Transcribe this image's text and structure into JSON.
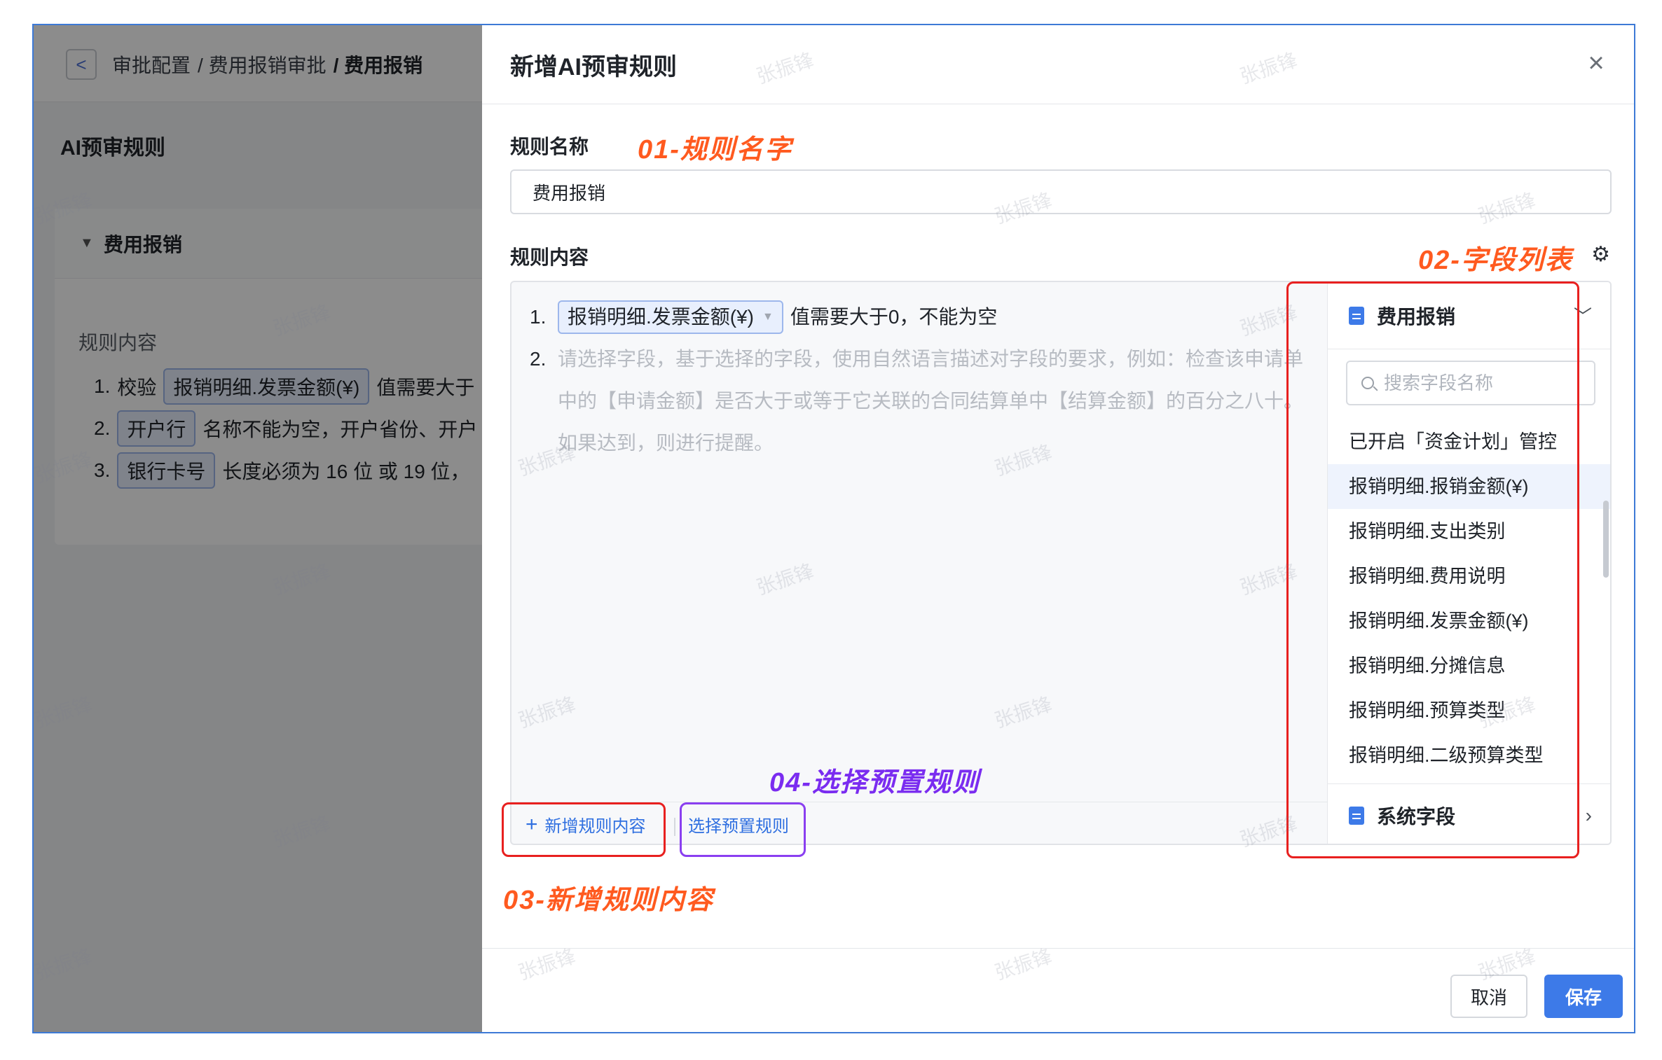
{
  "breadcrumb": {
    "back": "<",
    "items": [
      "审批配置",
      "/ 费用报销审批",
      "/ 费用报销"
    ]
  },
  "background": {
    "section_title": "AI预审规则",
    "card_title": "费用报销",
    "rule_label": "规则内容",
    "rules": [
      {
        "num": "1.",
        "prefix": "校验",
        "chip": "报销明细.发票金额(¥)",
        "text": "值需要大于"
      },
      {
        "num": "2.",
        "prefix": "",
        "chip": "开户行",
        "text": "名称不能为空，开户省份、开户"
      },
      {
        "num": "3.",
        "prefix": "",
        "chip": "银行卡号",
        "text": "长度必须为 16 位 或 19 位，"
      }
    ]
  },
  "modal": {
    "title": "新增AI预审规则",
    "close_icon": "×",
    "rule_name_label": "规则名称",
    "rule_name_value": "费用报销",
    "rule_content_label": "规则内容",
    "editor": {
      "line1": {
        "num": "1.",
        "chip": "报销明细.发票金额(¥)",
        "text": "值需要大于0，不能为空"
      },
      "line2": {
        "num": "2.",
        "placeholder": "请选择字段，基于选择的字段，使用自然语言描述对字段的要求，例如：检查该申请单中的【申请金额】是否大于或等于它关联的合同结算单中【结算金额】的百分之八十。如果达到，则进行提醒。"
      },
      "add_rule": "新增规则内容",
      "add_plus": "+",
      "select_preset": "选择预置规则"
    },
    "field_panel": {
      "group_title": "费用报销",
      "search_placeholder": "搜索字段名称",
      "fields": [
        "已开启「资金计划」管控",
        "报销明细.报销金额(¥)",
        "报销明细.支出类别",
        "报销明细.费用说明",
        "报销明细.发票金额(¥)",
        "报销明细.分摊信息",
        "报销明细.预算类型",
        "报销明细.二级预算类型"
      ],
      "active_index": 1,
      "system_group": "系统字段"
    },
    "cancel": "取消",
    "save": "保存"
  },
  "annotations": {
    "a01": "01-规则名字",
    "a02": "02-字段列表",
    "a03": "03-新增规则内容",
    "a04": "04-选择预置规则"
  },
  "watermark": "张振锋",
  "colors": {
    "primary": "#3d7ae8",
    "annotation_orange": "#ff5a1f",
    "annotation_red": "#e8201f",
    "annotation_purple": "#8a3ff0"
  }
}
